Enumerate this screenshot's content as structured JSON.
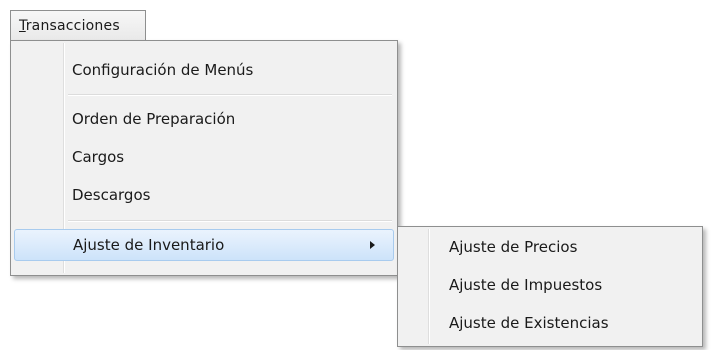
{
  "menubar": {
    "menu_mnemonic": "T",
    "menu_rest": "ransacciones"
  },
  "main_menu": {
    "items": [
      {
        "label": "Configuración de Menús"
      },
      {
        "label": "Orden de Preparación"
      },
      {
        "label": "Cargos"
      },
      {
        "label": "Descargos"
      },
      {
        "label": "Ajuste de Inventario",
        "has_submenu": true,
        "highlighted": true
      }
    ]
  },
  "submenu": {
    "items": [
      {
        "label": "Ajuste de Precios"
      },
      {
        "label": "Ajuste de Impuestos"
      },
      {
        "label": "Ajuste de Existencias"
      }
    ]
  },
  "colors": {
    "menu_background": "#f1f1f1",
    "menu_border": "#8e8f8f",
    "highlight_background": "#cde3fa",
    "highlight_border": "#a8cbee"
  },
  "icons": {
    "submenu_indicator": "chevron-right-icon"
  }
}
